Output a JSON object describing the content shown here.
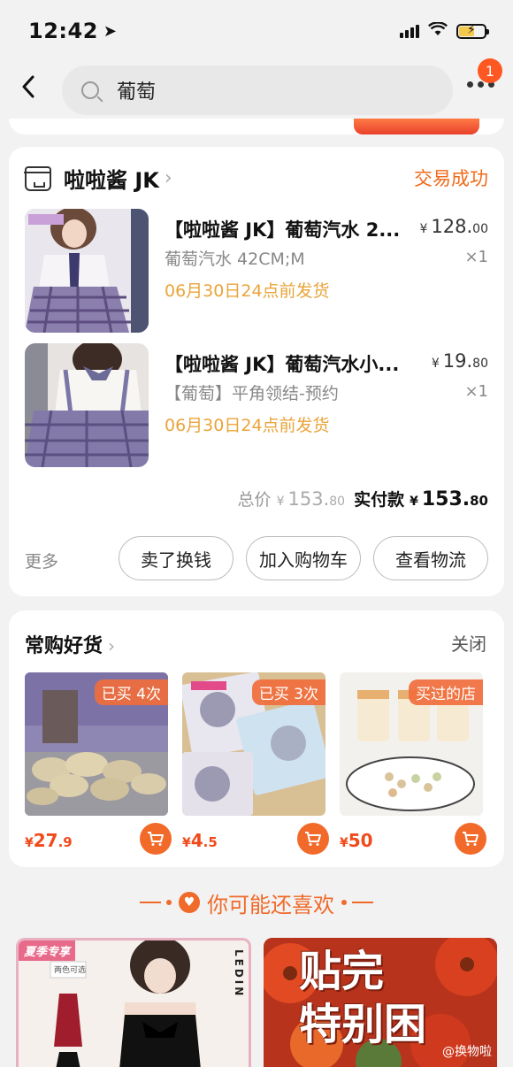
{
  "status_bar": {
    "time": "12:42"
  },
  "nav": {
    "search_text": "葡萄",
    "badge_count": "1"
  },
  "order": {
    "shop_name": "啦啦酱 JK",
    "status": "交易成功",
    "items": [
      {
        "title": "【啦啦酱 JK】葡萄汽水 2...",
        "price_int": "128.",
        "price_dec": "00",
        "sku": "葡萄汽水 42CM;M",
        "qty": "×1",
        "ship_note": "06月30日24点前发货",
        "thumb_label_top": "下款预约",
        "thumb_label_side": "葡萄汽水"
      },
      {
        "title": "【啦啦酱 JK】葡萄汽水小...",
        "price_int": "19.",
        "price_dec": "80",
        "sku": "【葡萄】平角领结-预约",
        "qty": "×1",
        "ship_note": "06月30日24点前发货"
      }
    ],
    "currency": "¥",
    "total_label": "总价",
    "total_int": "153.",
    "total_dec": "80",
    "paid_label": "实付款",
    "paid_int": "153.",
    "paid_dec": "80",
    "more_label": "更多",
    "actions": [
      "卖了换钱",
      "加入购物车",
      "查看物流"
    ]
  },
  "favorites": {
    "title": "常购好货",
    "close_label": "关闭",
    "items": [
      {
        "tag": "已买 4次",
        "price_int": "27",
        "price_dec": ".9"
      },
      {
        "tag": "已买 3次",
        "price_int": "4",
        "price_dec": ".5"
      },
      {
        "tag": "买过的店",
        "price_int": "50",
        "price_dec": ""
      }
    ]
  },
  "recommend": {
    "heading": "你可能还喜欢",
    "card1_tag": "夏季专享",
    "card1_brand": "LEDIN",
    "card1_chip": "两色可选",
    "card2_text_line1": "贴完",
    "card2_text_line2": "特别困",
    "watermark": "@换物啦"
  },
  "colors": {
    "accent": "#f06a1a",
    "ship_note": "#e9a43a",
    "price": "#f04a1a"
  }
}
